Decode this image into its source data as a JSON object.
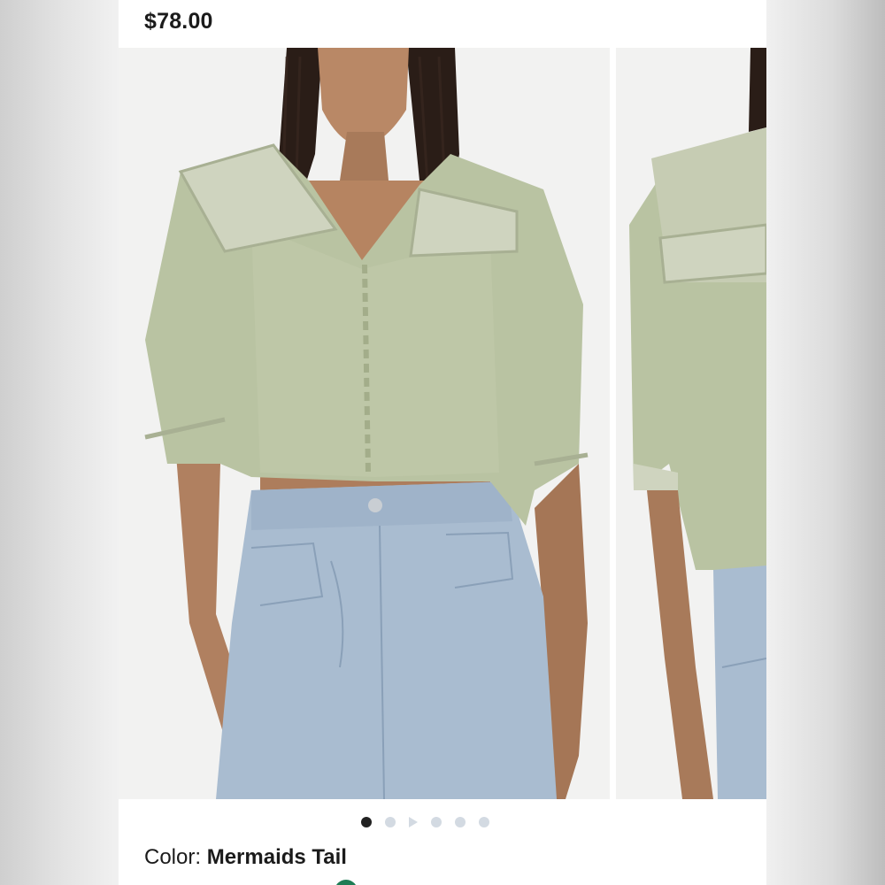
{
  "product": {
    "price": "$78.00",
    "color_label": "Color:",
    "color_value": "Mermaids Tail"
  },
  "carousel": {
    "slide_count": 6,
    "active_index": 0,
    "indicators": [
      "dot",
      "dot",
      "play",
      "dot",
      "dot",
      "dot"
    ]
  },
  "colors": {
    "background": "#ffffff",
    "photo_background": "#f2f2f1",
    "blouse": "#b9c3a2",
    "denim": "#a9bcd0",
    "dot_active": "#222222",
    "dot_inactive": "#d3dae2",
    "swatch": "#1e7d55"
  },
  "icons": {
    "play_indicator": "play-icon"
  }
}
